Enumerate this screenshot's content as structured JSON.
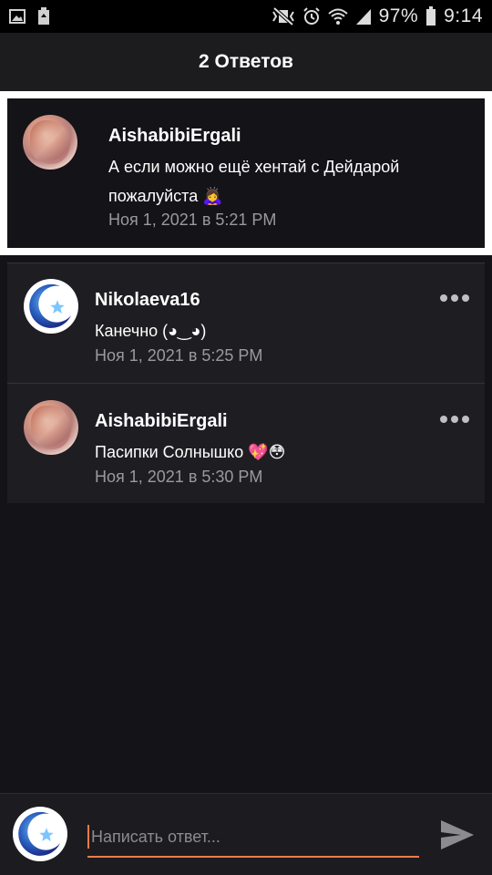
{
  "status_bar": {
    "battery": "97%",
    "time": "9:14",
    "icons": [
      "image-icon",
      "battery-saver-icon",
      "vibrate-mute-icon",
      "alarm-icon",
      "wifi-icon",
      "signal-icon",
      "battery-icon"
    ]
  },
  "header": {
    "title": "2 Ответов"
  },
  "original_comment": {
    "author": "AishabibiErgali",
    "text_line1": "А если можно ещё хентай с Дейдарой",
    "text_line2": "пожалуйста 🙇‍♀️",
    "timestamp": "Ноя 1, 2021 в 5:21 PM",
    "avatar": "anime-avatar"
  },
  "replies": [
    {
      "author": "Nikolaeva16",
      "text": "Канечно (◕‿◕)",
      "timestamp": "Ноя 1, 2021 в 5:25 PM",
      "avatar": "moon-star-avatar",
      "menu_icon": "more-dots-icon"
    },
    {
      "author": "AishabibiErgali",
      "text": "Пасипки Солнышко 💖😳",
      "timestamp": "Ноя 1, 2021 в 5:30 PM",
      "avatar": "anime-avatar",
      "menu_icon": "more-dots-icon"
    }
  ],
  "input_bar": {
    "placeholder": "Написать ответ...",
    "send_icon": "send-arrow-icon",
    "avatar": "moon-star-avatar"
  },
  "colors": {
    "background": "#141318",
    "accent": "#f07a4a",
    "muted_text": "#9a9a9e"
  }
}
